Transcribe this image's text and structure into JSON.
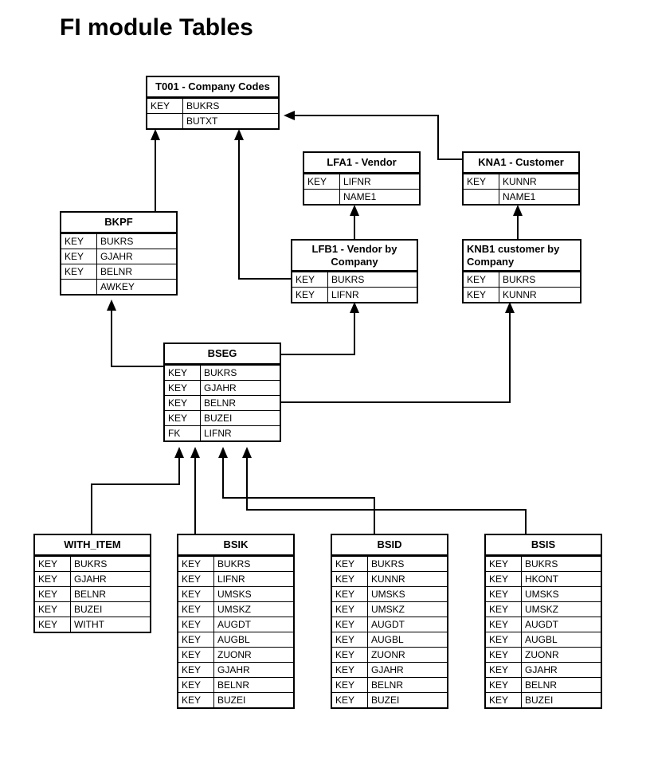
{
  "title": "FI module Tables",
  "entities": {
    "t001": {
      "header": "T001 - Company Codes",
      "rows": [
        {
          "k": "KEY",
          "f": "BUKRS"
        },
        {
          "k": "",
          "f": "BUTXT"
        }
      ]
    },
    "lfa1": {
      "header": "LFA1 - Vendor",
      "rows": [
        {
          "k": "KEY",
          "f": "LIFNR"
        },
        {
          "k": "",
          "f": "NAME1"
        }
      ]
    },
    "kna1": {
      "header": "KNA1 - Customer",
      "rows": [
        {
          "k": "KEY",
          "f": "KUNNR"
        },
        {
          "k": "",
          "f": "NAME1"
        }
      ]
    },
    "bkpf": {
      "header": "BKPF",
      "rows": [
        {
          "k": "KEY",
          "f": "BUKRS"
        },
        {
          "k": "KEY",
          "f": "GJAHR"
        },
        {
          "k": "KEY",
          "f": "BELNR"
        },
        {
          "k": "",
          "f": "AWKEY"
        }
      ]
    },
    "lfb1": {
      "header": "LFB1 - Vendor by Company",
      "rows": [
        {
          "k": "KEY",
          "f": "BUKRS"
        },
        {
          "k": "KEY",
          "f": "LIFNR"
        }
      ]
    },
    "knb1": {
      "header": "KNB1 customer by Company",
      "rows": [
        {
          "k": "KEY",
          "f": "BUKRS"
        },
        {
          "k": "KEY",
          "f": "KUNNR"
        }
      ]
    },
    "bseg": {
      "header": "BSEG",
      "rows": [
        {
          "k": "KEY",
          "f": "BUKRS"
        },
        {
          "k": "KEY",
          "f": "GJAHR"
        },
        {
          "k": "KEY",
          "f": "BELNR"
        },
        {
          "k": "KEY",
          "f": "BUZEI"
        },
        {
          "k": "FK",
          "f": "LIFNR"
        }
      ]
    },
    "with_item": {
      "header": "WITH_ITEM",
      "rows": [
        {
          "k": "KEY",
          "f": "BUKRS"
        },
        {
          "k": "KEY",
          "f": "GJAHR"
        },
        {
          "k": "KEY",
          "f": "BELNR"
        },
        {
          "k": "KEY",
          "f": "BUZEI"
        },
        {
          "k": "KEY",
          "f": "WITHT"
        }
      ]
    },
    "bsik": {
      "header": "BSIK",
      "rows": [
        {
          "k": "KEY",
          "f": "BUKRS"
        },
        {
          "k": "KEY",
          "f": "LIFNR"
        },
        {
          "k": "KEY",
          "f": "UMSKS"
        },
        {
          "k": "KEY",
          "f": "UMSKZ"
        },
        {
          "k": "KEY",
          "f": "AUGDT"
        },
        {
          "k": "KEY",
          "f": "AUGBL"
        },
        {
          "k": "KEY",
          "f": "ZUONR"
        },
        {
          "k": "KEY",
          "f": "GJAHR"
        },
        {
          "k": "KEY",
          "f": "BELNR"
        },
        {
          "k": "KEY",
          "f": "BUZEI"
        }
      ]
    },
    "bsid": {
      "header": "BSID",
      "rows": [
        {
          "k": "KEY",
          "f": "BUKRS"
        },
        {
          "k": "KEY",
          "f": "KUNNR"
        },
        {
          "k": "KEY",
          "f": "UMSKS"
        },
        {
          "k": "KEY",
          "f": "UMSKZ"
        },
        {
          "k": "KEY",
          "f": "AUGDT"
        },
        {
          "k": "KEY",
          "f": "AUGBL"
        },
        {
          "k": "KEY",
          "f": "ZUONR"
        },
        {
          "k": "KEY",
          "f": "GJAHR"
        },
        {
          "k": "KEY",
          "f": "BELNR"
        },
        {
          "k": "KEY",
          "f": "BUZEI"
        }
      ]
    },
    "bsis": {
      "header": "BSIS",
      "rows": [
        {
          "k": "KEY",
          "f": "BUKRS"
        },
        {
          "k": "KEY",
          "f": "HKONT"
        },
        {
          "k": "KEY",
          "f": "UMSKS"
        },
        {
          "k": "KEY",
          "f": "UMSKZ"
        },
        {
          "k": "KEY",
          "f": "AUGDT"
        },
        {
          "k": "KEY",
          "f": "AUGBL"
        },
        {
          "k": "KEY",
          "f": "ZUONR"
        },
        {
          "k": "KEY",
          "f": "GJAHR"
        },
        {
          "k": "KEY",
          "f": "BELNR"
        },
        {
          "k": "KEY",
          "f": "BUZEI"
        }
      ]
    }
  }
}
